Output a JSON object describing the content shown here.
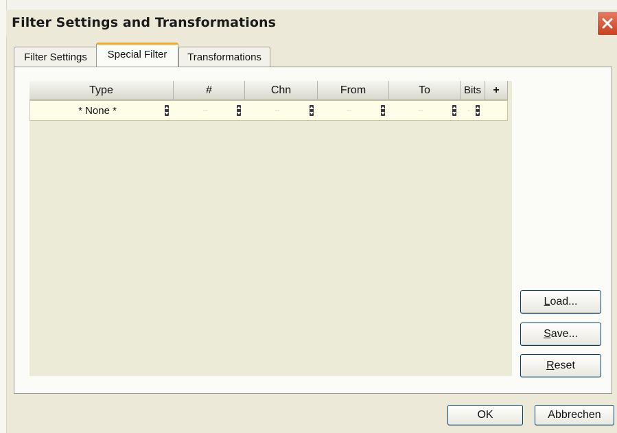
{
  "window": {
    "title": "Filter Settings and Transformations"
  },
  "tabs": [
    {
      "label": "Filter Settings",
      "active": false
    },
    {
      "label": "Special Filter",
      "active": true
    },
    {
      "label": "Transformations",
      "active": false
    }
  ],
  "grid": {
    "columns": [
      "Type",
      "#",
      "Chn",
      "From",
      "To",
      "Bits",
      "+"
    ],
    "rows": [
      {
        "type": "* None *",
        "num": "--",
        "chn": "--",
        "from": "--",
        "to": "--",
        "bits": "-"
      }
    ]
  },
  "side_buttons": {
    "load": {
      "mnemonic": "L",
      "rest": "oad..."
    },
    "save": {
      "mnemonic": "S",
      "rest": "ave..."
    },
    "reset": {
      "mnemonic": "R",
      "rest": "eset"
    }
  },
  "footer": {
    "ok_label": "OK",
    "cancel_label": "Abbrechen"
  },
  "colors": {
    "dialog_bg": "#ece9d8",
    "grid_bg": "#ebebd8",
    "row_bg": "#fdfde8",
    "tab_highlight": "#f5a623",
    "close_button": "#c9411f",
    "button_border": "#003c74"
  }
}
